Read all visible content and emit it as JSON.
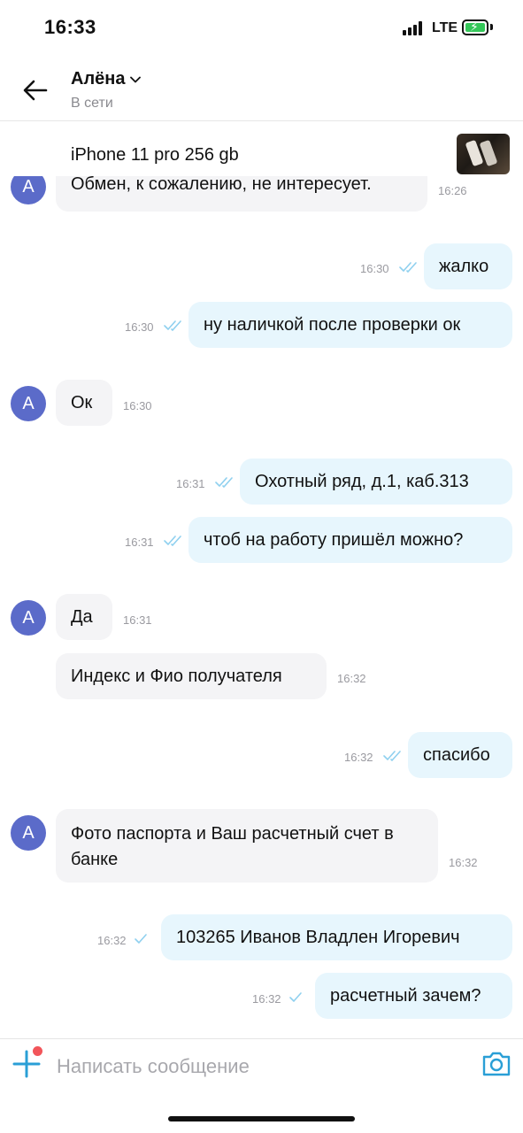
{
  "status_bar": {
    "time": "16:33",
    "network": "LTE"
  },
  "header": {
    "name": "Алёна",
    "status": "В сети"
  },
  "product": {
    "title": "iPhone 11 pro 256 gb"
  },
  "avatar_letter": "А",
  "messages": [
    {
      "dir": "in",
      "text": "Обмен, к сожалению, не интересует.",
      "time": "16:26"
    },
    {
      "dir": "out",
      "text": "жалко",
      "time": "16:30",
      "status": "read"
    },
    {
      "dir": "out",
      "text": "ну наличкой после проверки ок",
      "time": "16:30",
      "status": "read"
    },
    {
      "dir": "in",
      "text": "Ок",
      "time": "16:30"
    },
    {
      "dir": "out",
      "text": "Охотный ряд, д.1, каб.313",
      "time": "16:31",
      "status": "read"
    },
    {
      "dir": "out",
      "text": "чтоб на работу пришёл можно?",
      "time": "16:31",
      "status": "read"
    },
    {
      "dir": "in",
      "text": "Да",
      "time": "16:31"
    },
    {
      "dir": "in",
      "text": "Индекс и Фио получателя",
      "time": "16:32"
    },
    {
      "dir": "out",
      "text": "спасибо",
      "time": "16:32",
      "status": "read"
    },
    {
      "dir": "in",
      "text": "Фото паспорта и Ваш расчетный счет в банке",
      "time": "16:32"
    },
    {
      "dir": "out",
      "text": "103265 Иванов Владлен Игоревич",
      "time": "16:32",
      "status": "sent"
    },
    {
      "dir": "out",
      "text": "расчетный зачем?",
      "time": "16:32",
      "status": "sent"
    }
  ],
  "composer": {
    "placeholder": "Написать сообщение"
  },
  "colors": {
    "accent": "#2a9fd6",
    "incoming_bubble": "#f4f4f6",
    "outgoing_bubble": "#e7f6fd",
    "avatar": "#5b6bc9",
    "battery": "#34c759",
    "notification_dot": "#f2555a"
  }
}
